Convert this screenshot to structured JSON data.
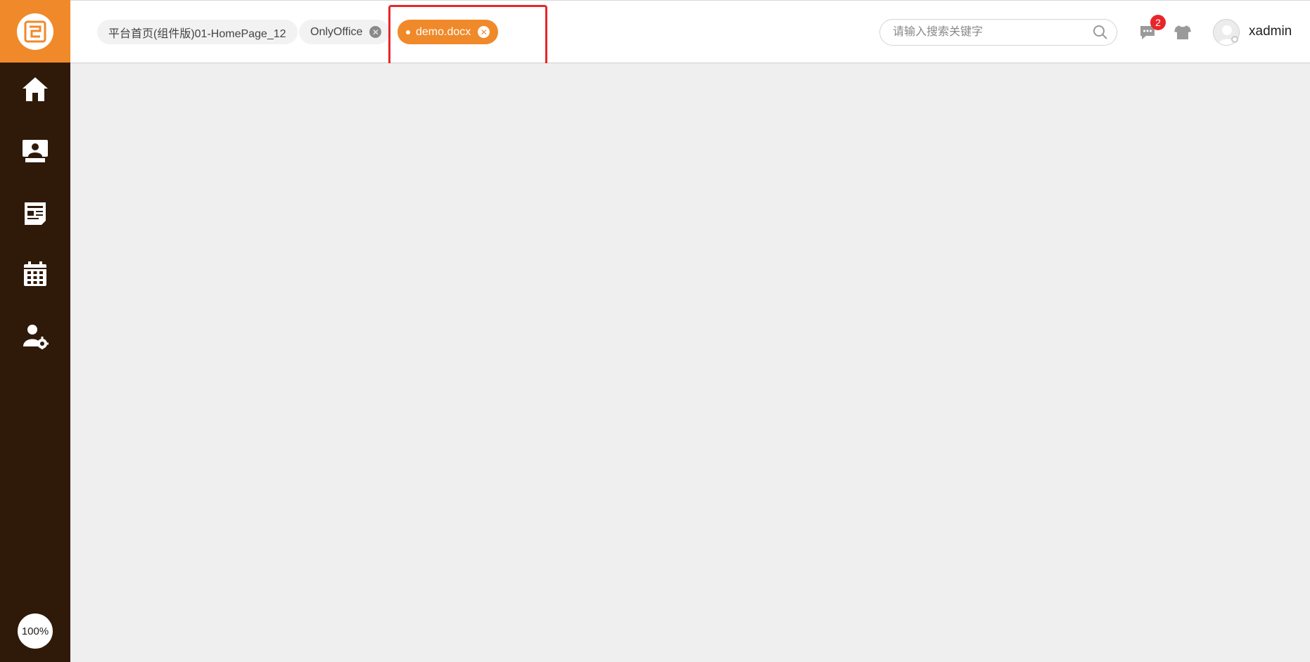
{
  "colors": {
    "accent": "#f0892a",
    "sidebar_bg": "#2f1a0a",
    "content_bg": "#efefef",
    "badge_red": "#e8262a"
  },
  "sidebar": {
    "logo_icon": "app-logo-icon",
    "items": [
      {
        "icon": "home-icon"
      },
      {
        "icon": "monitor-user-icon"
      },
      {
        "icon": "news-document-icon"
      },
      {
        "icon": "calendar-icon"
      },
      {
        "icon": "user-settings-icon"
      }
    ],
    "zoom_label": "100%"
  },
  "tabs": [
    {
      "label": "平台首页(组件版)01-HomePage_12",
      "active": false,
      "closable": false
    },
    {
      "label": "OnlyOffice",
      "active": false,
      "closable": true
    },
    {
      "label": "demo.docx",
      "active": true,
      "closable": true
    }
  ],
  "search": {
    "placeholder": "请输入搜索关键字",
    "value": ""
  },
  "header": {
    "message_count": "2",
    "username": "xadmin"
  }
}
